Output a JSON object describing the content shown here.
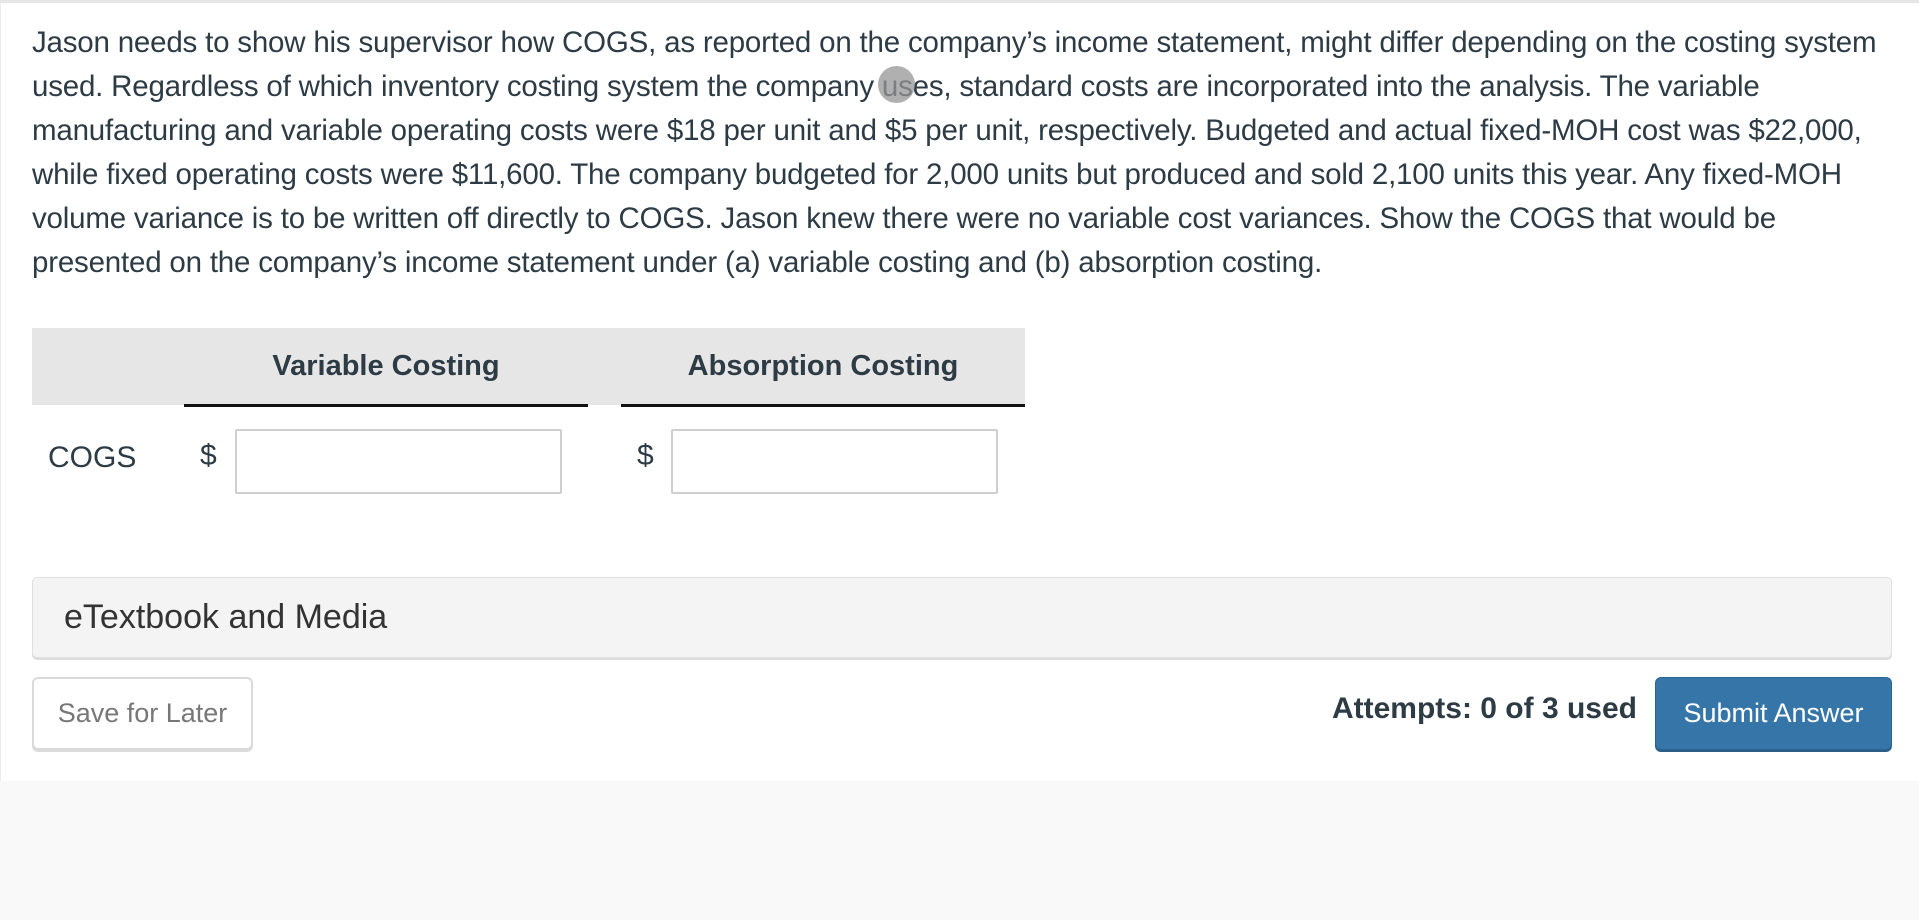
{
  "question": {
    "text": "Jason needs to show his supervisor how COGS, as reported on the company’s income statement, might differ depending on the costing system used. Regardless of which inventory costing system the company uses, standard costs are incorporated into the analysis. The variable manufacturing and variable operating costs were $18 per unit and $5 per unit, respectively. Budgeted and actual fixed-MOH cost was $22,000, while fixed operating costs were $11,600. The company budgeted for 2,000 units but produced and sold 2,100 units this year. Any fixed-MOH volume variance is to be written off directly to COGS. Jason knew there were no variable cost variances. Show the COGS that would be presented on the company’s income statement under (a) variable costing and (b) absorption costing."
  },
  "answer_grid": {
    "columns": [
      {
        "label": "Variable Costing"
      },
      {
        "label": "Absorption Costing"
      }
    ],
    "rows": [
      {
        "label": "COGS",
        "cells": [
          {
            "currency": "$",
            "value": ""
          },
          {
            "currency": "$",
            "value": ""
          }
        ]
      }
    ]
  },
  "media_panel": {
    "label": "eTextbook and Media"
  },
  "footer": {
    "save_label": "Save for Later",
    "attempts_text": "Attempts: 0 of 3 used",
    "submit_label": "Submit Answer"
  },
  "colors": {
    "submit_button": "#3575a7",
    "text": "#2d3b45",
    "header_bg": "#e6e6e6"
  }
}
